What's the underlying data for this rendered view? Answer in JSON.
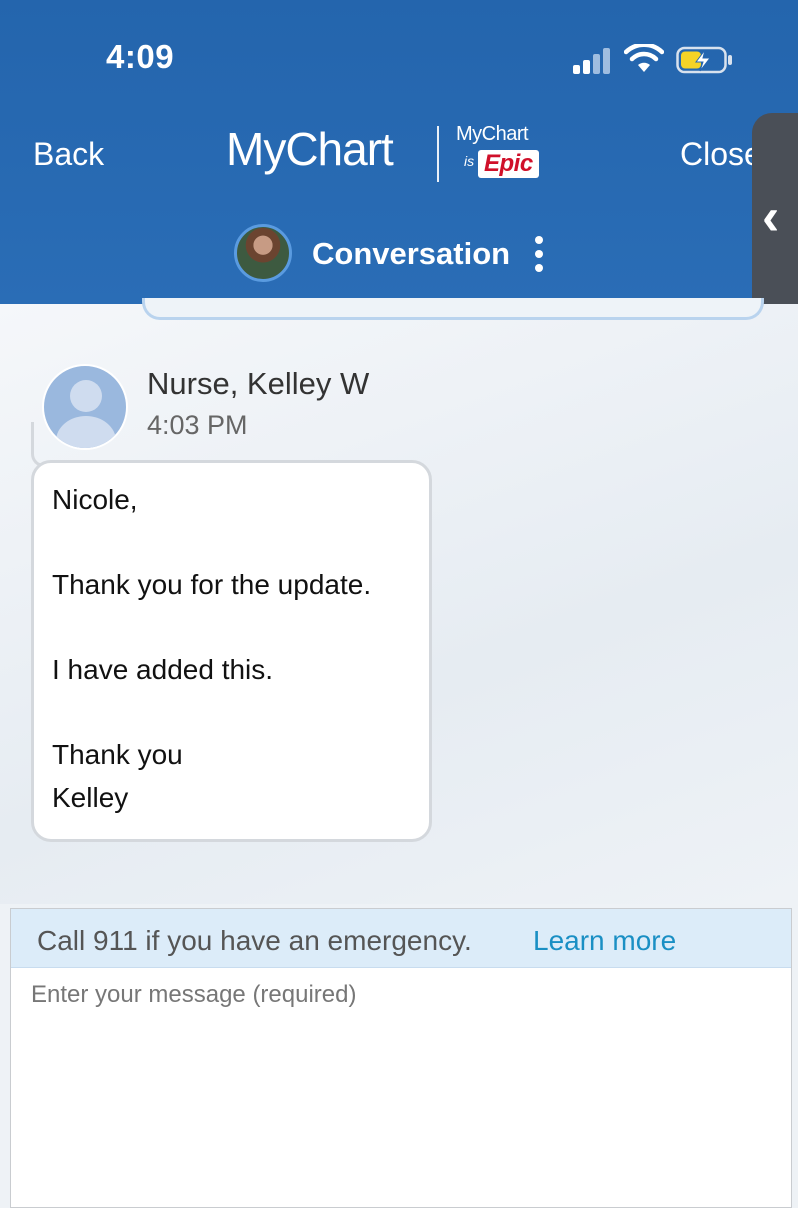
{
  "status_bar": {
    "time": "4:09"
  },
  "header": {
    "back_label": "Back",
    "logo_main": "MyChart",
    "logo_small": "MyChart",
    "logo_is": "is",
    "logo_epic": "Epic",
    "close_label": "Close",
    "title": "Conversation",
    "colors": {
      "header_bg": "#2667b0",
      "epic_red": "#d0102a"
    }
  },
  "message": {
    "sender_name": "Nurse, Kelley W",
    "time": "4:03 PM",
    "lines": [
      "Nicole,",
      "Thank you for the update.",
      "I have added this.",
      "Thank you",
      "Kelley"
    ]
  },
  "compose": {
    "emergency_text": "Call 911 if you have an emergency.",
    "learn_more": "Learn more",
    "placeholder": "Enter your message (required)",
    "value": ""
  },
  "icons": [
    "signal-icon",
    "wifi-icon",
    "battery-charging-icon",
    "kebab-menu-icon",
    "chevron-left-icon",
    "user-avatar-icon"
  ]
}
